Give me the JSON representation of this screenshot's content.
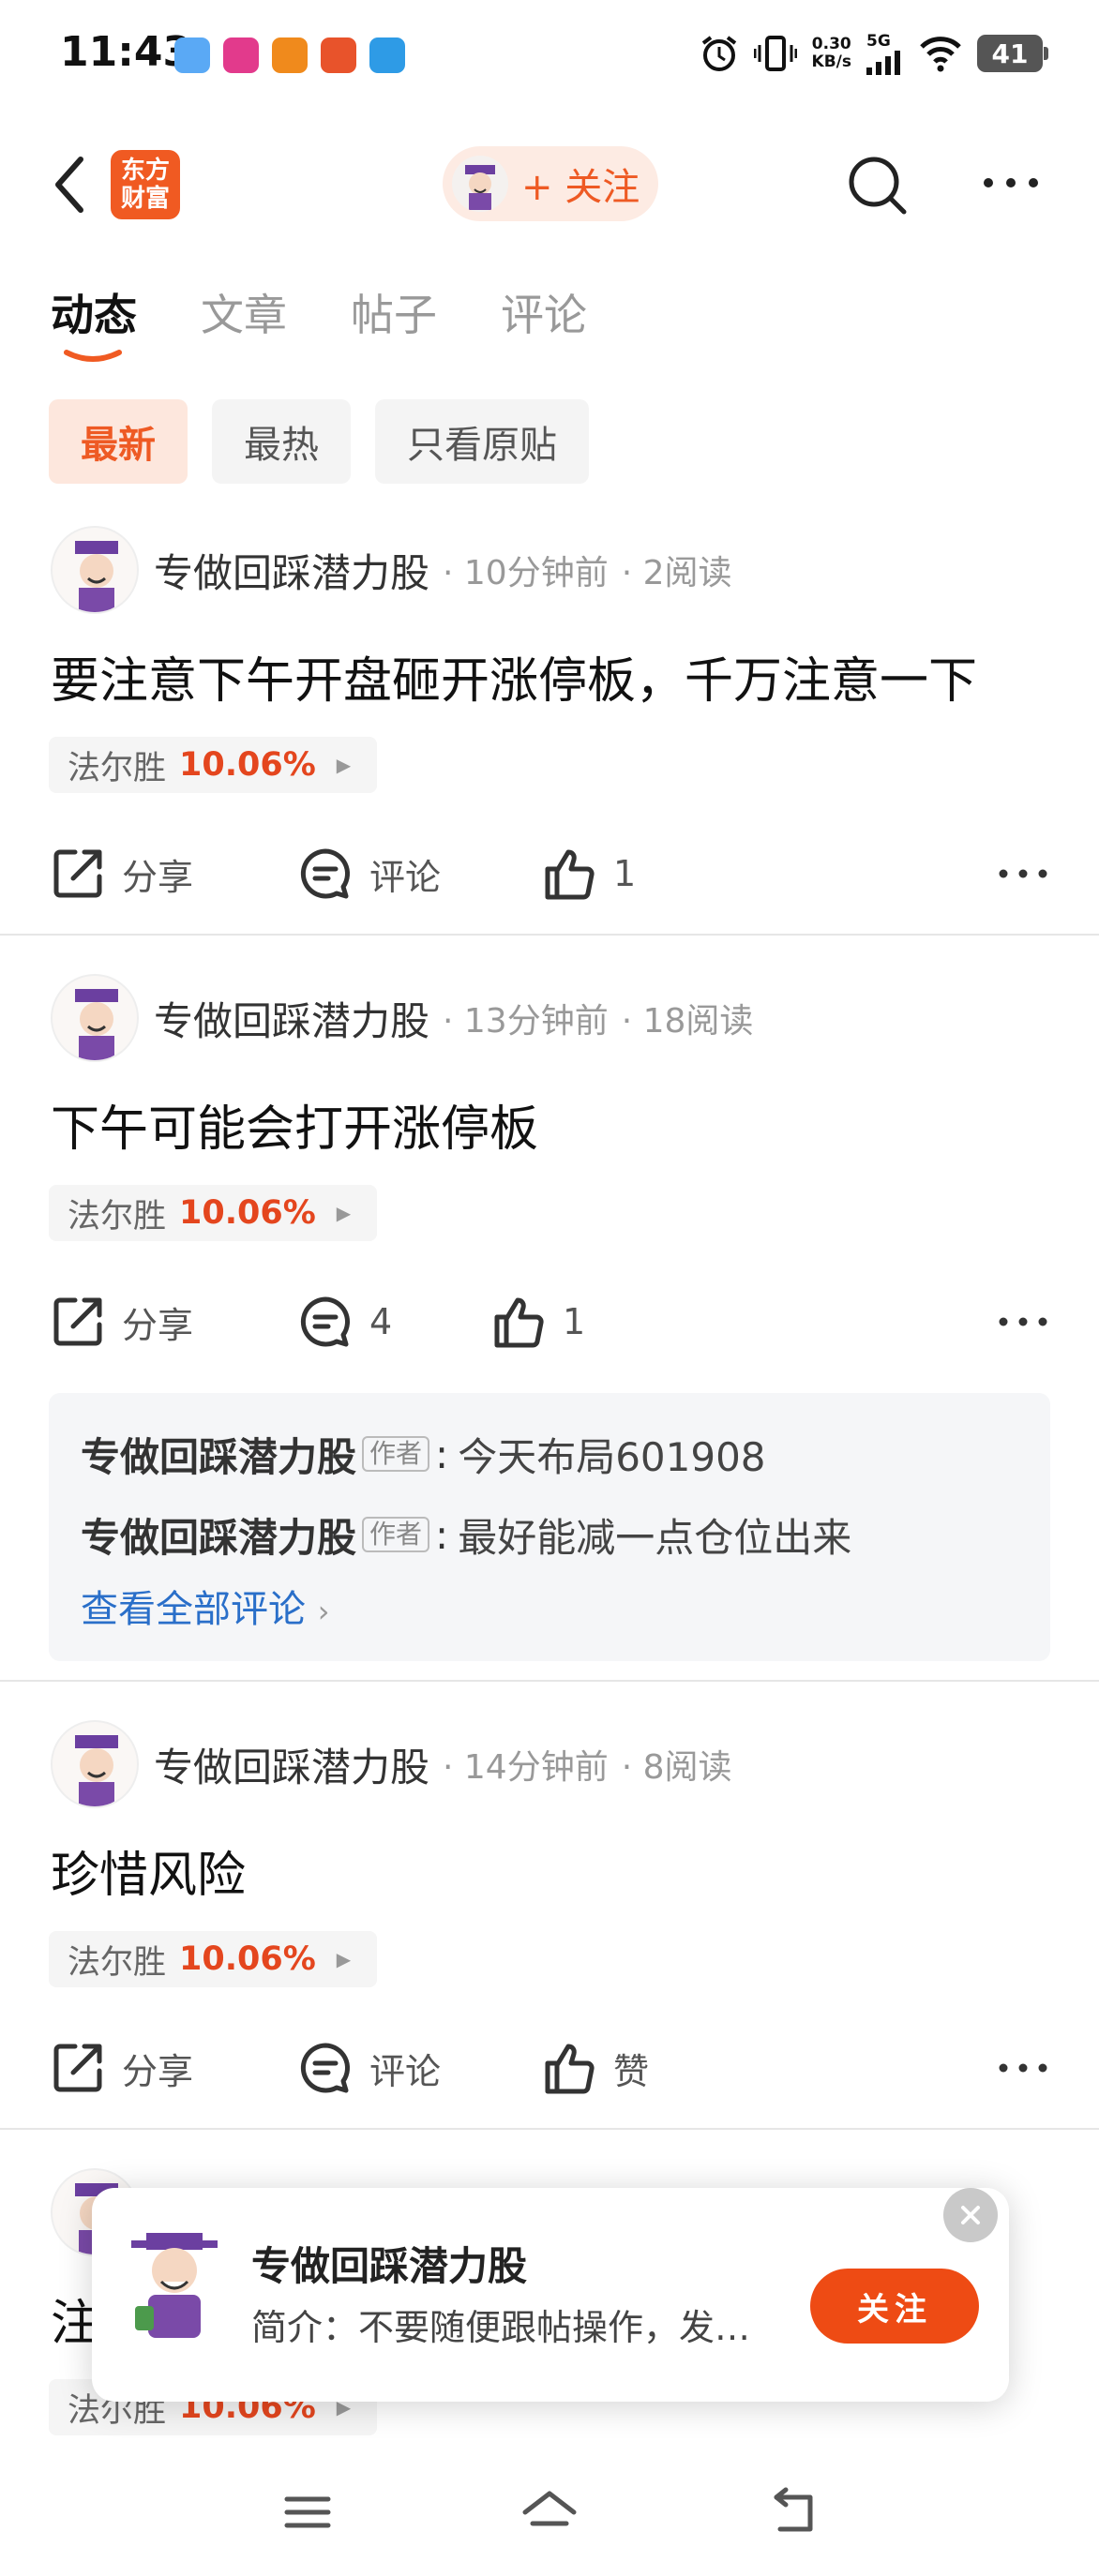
{
  "status_bar": {
    "time": "11:43",
    "net_speed_value": "0.30",
    "net_speed_unit": "KB/s",
    "network": "5G",
    "battery": "41"
  },
  "header": {
    "brand_line1": "东方",
    "brand_line2": "财富",
    "follow_label": "+ 关注"
  },
  "tabs": [
    {
      "label": "动态",
      "active": true
    },
    {
      "label": "文章",
      "active": false
    },
    {
      "label": "帖子",
      "active": false
    },
    {
      "label": "评论",
      "active": false
    }
  ],
  "filters": [
    {
      "label": "最新",
      "active": true
    },
    {
      "label": "最热",
      "active": false
    },
    {
      "label": "只看原贴",
      "active": false
    }
  ],
  "posts": [
    {
      "author": "专做回踩潜力股",
      "time": "· 10分钟前",
      "reads": "· 2阅读",
      "text": "要注意下午开盘砸开涨停板，千万注意一下",
      "stock_name": "法尔胜",
      "stock_pct": "10.06%",
      "share": "分享",
      "comment": "评论",
      "like": "1"
    },
    {
      "author": "专做回踩潜力股",
      "time": "· 13分钟前",
      "reads": "· 18阅读",
      "text": "下午可能会打开涨停板",
      "stock_name": "法尔胜",
      "stock_pct": "10.06%",
      "share": "分享",
      "comment": "4",
      "like": "1",
      "comments": [
        {
          "name": "专做回踩潜力股",
          "badge": "作者",
          "text": "今天布局601908"
        },
        {
          "name": "专做回踩潜力股",
          "badge": "作者",
          "text": "最好能减一点仓位出来"
        }
      ],
      "view_all": "查看全部评论"
    },
    {
      "author": "专做回踩潜力股",
      "time": "· 14分钟前",
      "reads": "· 8阅读",
      "text": "珍惜风险",
      "stock_name": "法尔胜",
      "stock_pct": "10.06%",
      "share": "分享",
      "comment": "评论",
      "like": "赞"
    },
    {
      "text": "注",
      "stock_name": "法尔胜",
      "stock_pct": "10.06%"
    }
  ],
  "popup": {
    "name": "专做回踩潜力股",
    "desc": "简介：不要随便跟帖操作，发…",
    "follow": "关注"
  },
  "colors": {
    "accent": "#ee5a24",
    "stock_up": "#e4461e",
    "link": "#2a6fc9"
  }
}
